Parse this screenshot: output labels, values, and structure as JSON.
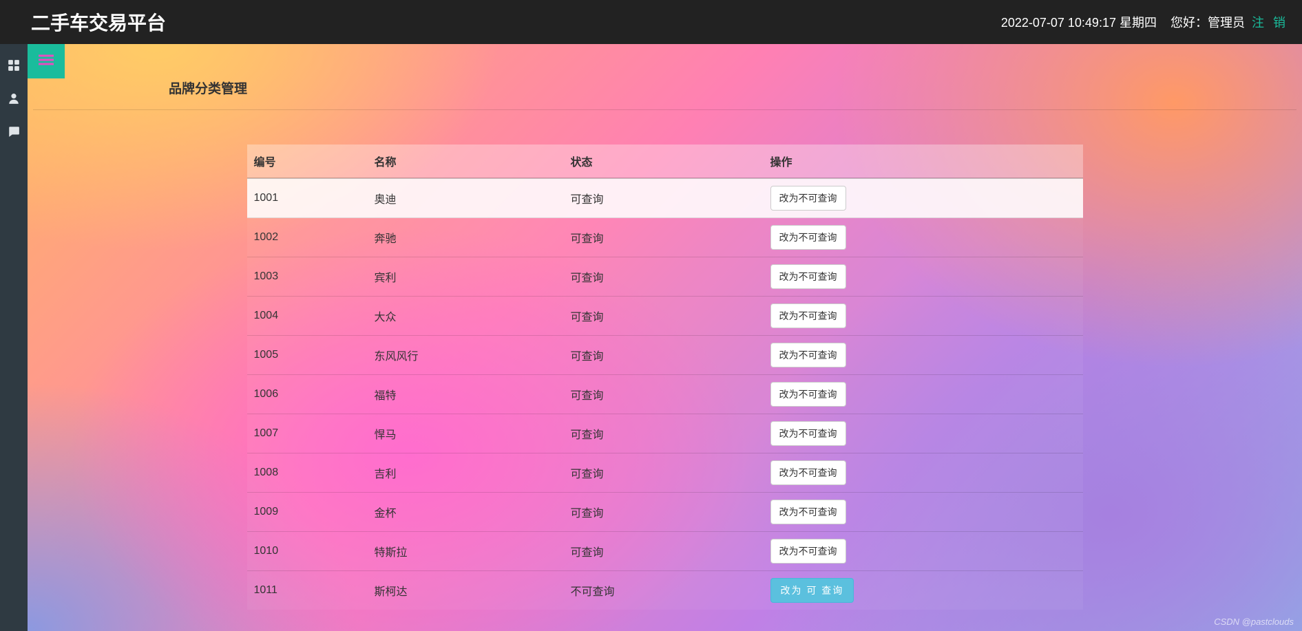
{
  "topbar": {
    "title": "二手车交易平台",
    "datetime": "2022-07-07 10:49:17 星期四",
    "greeting": "您好：管理员",
    "logout": "注 销"
  },
  "page": {
    "title": "品牌分类管理"
  },
  "table": {
    "headers": {
      "id": "编号",
      "name": "名称",
      "status": "状态",
      "action": "操作"
    },
    "rows": [
      {
        "id": "1001",
        "name": "奥迪",
        "status": "可查询",
        "action": "改为不可查询",
        "alt": false,
        "highlight": true
      },
      {
        "id": "1002",
        "name": "奔驰",
        "status": "可查询",
        "action": "改为不可查询",
        "alt": false,
        "highlight": false
      },
      {
        "id": "1003",
        "name": "宾利",
        "status": "可查询",
        "action": "改为不可查询",
        "alt": false,
        "highlight": false
      },
      {
        "id": "1004",
        "name": "大众",
        "status": "可查询",
        "action": "改为不可查询",
        "alt": false,
        "highlight": false
      },
      {
        "id": "1005",
        "name": "东风风行",
        "status": "可查询",
        "action": "改为不可查询",
        "alt": false,
        "highlight": false
      },
      {
        "id": "1006",
        "name": "福特",
        "status": "可查询",
        "action": "改为不可查询",
        "alt": false,
        "highlight": false
      },
      {
        "id": "1007",
        "name": "悍马",
        "status": "可查询",
        "action": "改为不可查询",
        "alt": false,
        "highlight": false
      },
      {
        "id": "1008",
        "name": "吉利",
        "status": "可查询",
        "action": "改为不可查询",
        "alt": false,
        "highlight": false
      },
      {
        "id": "1009",
        "name": "金杯",
        "status": "可查询",
        "action": "改为不可查询",
        "alt": false,
        "highlight": false
      },
      {
        "id": "1010",
        "name": "特斯拉",
        "status": "可查询",
        "action": "改为不可查询",
        "alt": false,
        "highlight": false
      },
      {
        "id": "1011",
        "name": "斯柯达",
        "status": "不可查询",
        "action": "改为 可 查询",
        "alt": true,
        "highlight": false
      }
    ]
  },
  "watermark": "CSDN @pastclouds"
}
